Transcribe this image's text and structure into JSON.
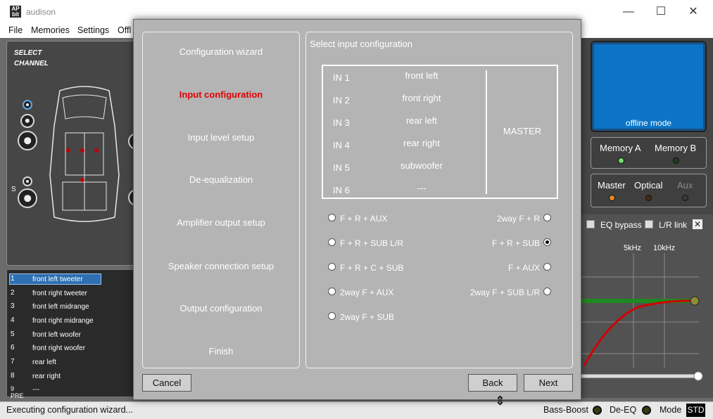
{
  "window": {
    "app_icon_text": "AP bit",
    "title": "audison",
    "minimize_glyph": "—",
    "maximize_glyph": "☐",
    "close_glyph": "✕"
  },
  "menu": [
    "File",
    "Memories",
    "Settings",
    "Offl"
  ],
  "left_panel": {
    "select_channel": "SELECT CHANNEL",
    "side_letter": "S"
  },
  "channels": [
    {
      "num": "1",
      "name": "front left tweeter",
      "selected": true
    },
    {
      "num": "2",
      "name": "front right tweeter"
    },
    {
      "num": "3",
      "name": "front left midrange"
    },
    {
      "num": "4",
      "name": "front right midrange"
    },
    {
      "num": "5",
      "name": "front left woofer"
    },
    {
      "num": "6",
      "name": "front right woofer"
    },
    {
      "num": "7",
      "name": "rear left"
    },
    {
      "num": "8",
      "name": "rear right"
    },
    {
      "num": "9 PRE",
      "name": "---"
    }
  ],
  "right_panel": {
    "offline_mode": "offline mode",
    "memory_a": "Memory A",
    "memory_b": "Memory B",
    "master": "Master",
    "optical": "Optical",
    "aux": "Aux",
    "eq_bypass": "EQ bypass",
    "lr_link": "L/R link",
    "freq_5k": "5kHz",
    "freq_10k": "10kHz",
    "colors": {
      "led_green": "#6fe06f",
      "led_orange": "#e08a20",
      "curve_red": "#d00000",
      "curve_green": "#1f8a1f"
    }
  },
  "dialog": {
    "steps": [
      {
        "label": "Configuration wizard"
      },
      {
        "label": "Input configuration",
        "active": true
      },
      {
        "label": "Input level setup"
      },
      {
        "label": "De-equalization"
      },
      {
        "label": "Amplifier output setup"
      },
      {
        "label": "Speaker connection setup"
      },
      {
        "label": "Output configuration"
      },
      {
        "label": "Finish"
      }
    ],
    "config_title": "Select input configuration",
    "inputs": [
      {
        "id": "IN 1",
        "name": "front left"
      },
      {
        "id": "IN 2",
        "name": "front right"
      },
      {
        "id": "IN 3",
        "name": "rear left"
      },
      {
        "id": "IN 4",
        "name": "rear right"
      },
      {
        "id": "IN 5",
        "name": "subwoofer"
      },
      {
        "id": "IN 6",
        "name": "---"
      }
    ],
    "master_label": "MASTER",
    "options_left": [
      "F + R + AUX",
      "F + R + SUB L/R",
      "F + R + C + SUB",
      "2way F + AUX",
      "2way F + SUB"
    ],
    "options_right": [
      "2way F + R",
      "F + R + SUB",
      "F + AUX",
      "2way F + SUB L/R"
    ],
    "selected_option": "F + R + SUB",
    "cancel_label": "Cancel",
    "back_label": "Back",
    "next_label": "Next",
    "active_step_color": "#e00000"
  },
  "statusbar": {
    "text": "Executing configuration wizard...",
    "bass_boost": "Bass-Boost",
    "de_eq": "De-EQ",
    "mode": "Mode",
    "mode_value": "STD"
  }
}
